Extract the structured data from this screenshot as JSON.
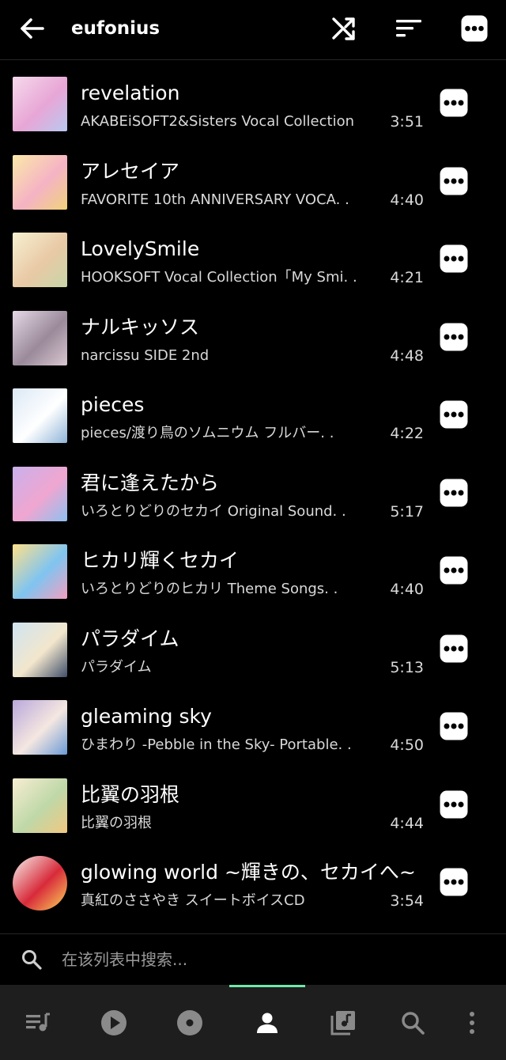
{
  "header": {
    "title": "eufonius",
    "back_icon": "arrow-left-icon",
    "shuffle_icon": "shuffle-icon",
    "sort_icon": "sort-icon",
    "menu_icon": "more-horizontal-icon"
  },
  "tracks": [
    {
      "title": "revelation",
      "album": "AKABEiSOFT2&Sisters Vocal Collection",
      "duration": "3:51"
    },
    {
      "title": "アレセイア",
      "album": "FAVORITE 10th ANNIVERSARY VOCA. .",
      "duration": "4:40"
    },
    {
      "title": "LovelySmile",
      "album": "HOOKSOFT Vocal Collection「My Smi. .",
      "duration": "4:21"
    },
    {
      "title": "ナルキッソス",
      "album": "narcissu SIDE 2nd",
      "duration": "4:48"
    },
    {
      "title": "pieces",
      "album": "pieces/渡り鳥のソムニウム フルバー. .",
      "duration": "4:22"
    },
    {
      "title": "君に逢えたから",
      "album": "いろとりどりのセカイ Original Sound. .",
      "duration": "5:17"
    },
    {
      "title": "ヒカリ輝くセカイ",
      "album": "いろとりどりのヒカリ Theme Songs. .",
      "duration": "4:40"
    },
    {
      "title": "パラダイム",
      "album": "パラダイム",
      "duration": "5:13"
    },
    {
      "title": "gleaming sky",
      "album": "ひまわり -Pebble in the Sky- Portable. .",
      "duration": "4:50"
    },
    {
      "title": "比翼の羽根",
      "album": "比翼の羽根",
      "duration": "4:44"
    },
    {
      "title": "glowing world ~輝きの、セカイへ~",
      "album": "真紅のささやき スイートボイスCD",
      "duration": "3:54"
    }
  ],
  "search": {
    "placeholder": "在该列表中搜索...",
    "icon": "search-icon"
  },
  "bottom_nav": {
    "items": [
      {
        "icon": "queue-music-icon",
        "active": false
      },
      {
        "icon": "play-circle-icon",
        "active": false
      },
      {
        "icon": "album-disc-icon",
        "active": false
      },
      {
        "icon": "person-icon",
        "active": true
      },
      {
        "icon": "music-library-icon",
        "active": false
      },
      {
        "icon": "search-icon",
        "active": false
      },
      {
        "icon": "more-vertical-icon",
        "active": false
      }
    ],
    "accent": "#6ee7a8",
    "inactive_color": "#8a8a8a"
  },
  "colors": {
    "background": "#000000",
    "nav_background": "#1e1e1e",
    "text_primary": "#ffffff",
    "text_secondary": "#d9d9d9"
  }
}
